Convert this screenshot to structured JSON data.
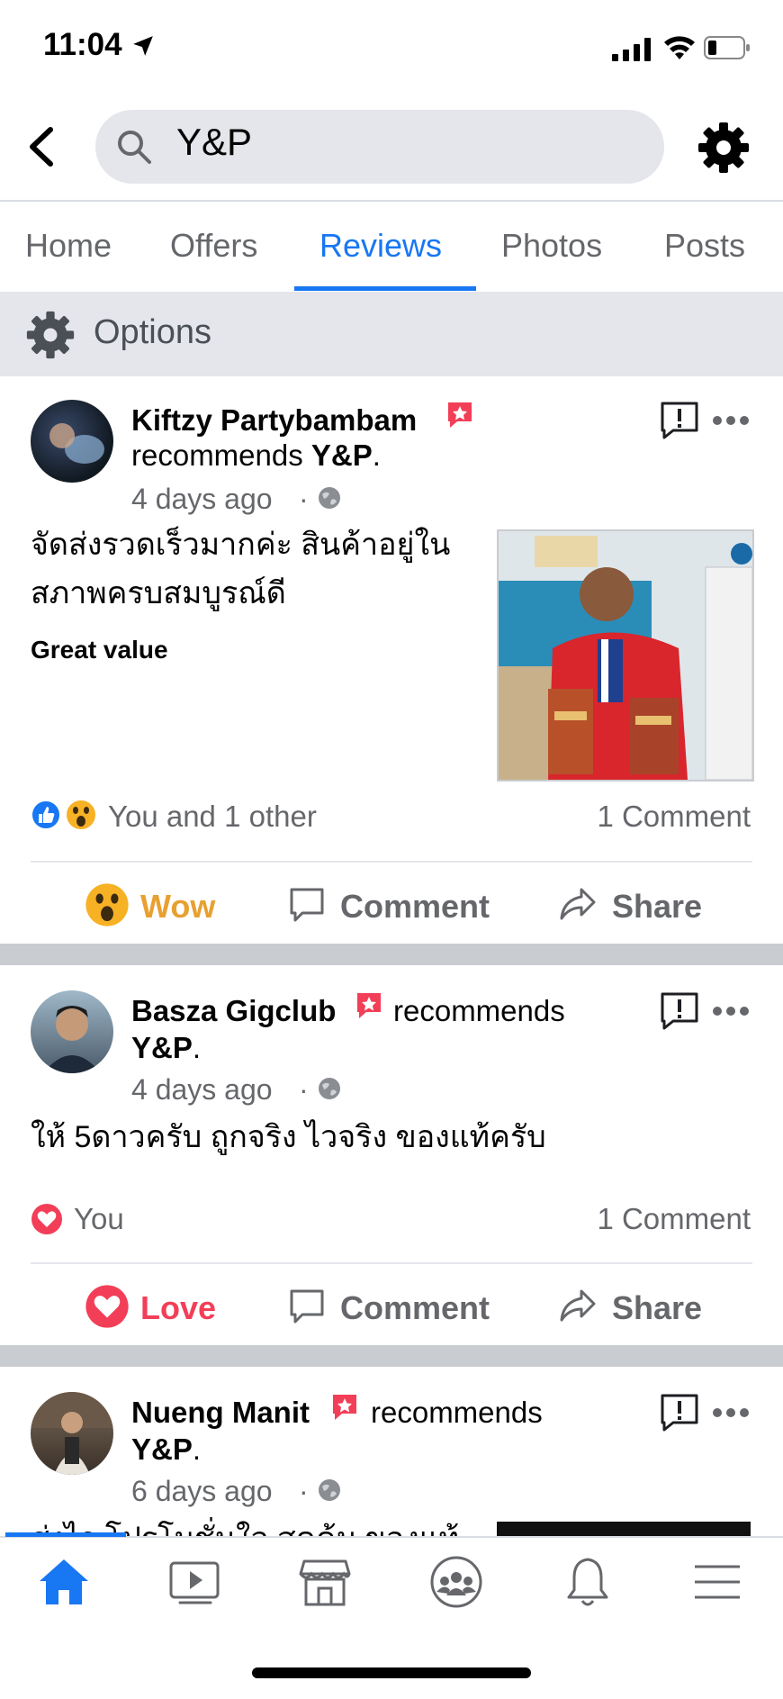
{
  "status_bar": {
    "time": "11:04"
  },
  "header": {
    "search_text": "Y&P"
  },
  "tabs": [
    {
      "label": "Home"
    },
    {
      "label": "Offers"
    },
    {
      "label": "Reviews"
    },
    {
      "label": "Photos"
    },
    {
      "label": "Posts"
    }
  ],
  "options": {
    "label": "Options"
  },
  "posts": [
    {
      "author": "Kiftzy Partybambam",
      "recommends": "recommends",
      "page": "Y&P",
      "time": "4 days ago",
      "text_line1": "จัดส่งรวดเร็วมากค่ะ สินค้าอยู่ใน",
      "text_line2": "สภาพครบสมบูรณ์ดี",
      "tag": "Great value",
      "reactions": "You and 1 other",
      "comments": "1 Comment",
      "action_react": "Wow",
      "action_comment": "Comment",
      "action_share": "Share"
    },
    {
      "author": "Basza Gigclub",
      "recommends": "recommends",
      "page": "Y&P",
      "time": "4 days ago",
      "text_line1": "ให้ 5ดาวครับ ถูกจริง ไวจริง ของแท้ครับ",
      "reactions": "You",
      "comments": "1 Comment",
      "action_react": "Love",
      "action_comment": "Comment",
      "action_share": "Share"
    },
    {
      "author": "Nueng Manit",
      "recommends": "recommends",
      "page": "Y&P",
      "time": "6 days ago",
      "text_line1": "ส่งไว โปรโมชั่นใจ สุดคุ้ม ของแท้"
    }
  ],
  "colors": {
    "accent": "#1877f2",
    "wow": "#f0a83a",
    "love": "#f33e58"
  }
}
